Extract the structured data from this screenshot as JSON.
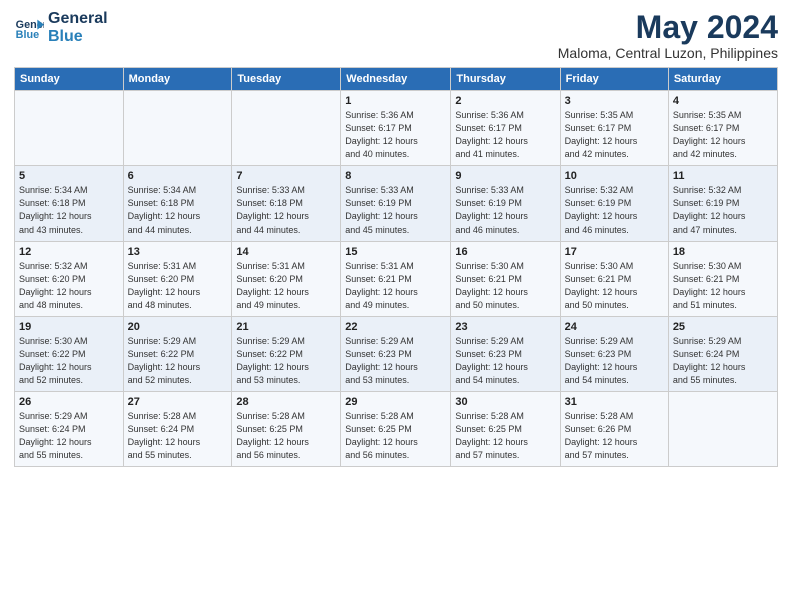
{
  "header": {
    "logo_line1": "General",
    "logo_line2": "Blue",
    "month_title": "May 2024",
    "subtitle": "Maloma, Central Luzon, Philippines"
  },
  "days_of_week": [
    "Sunday",
    "Monday",
    "Tuesday",
    "Wednesday",
    "Thursday",
    "Friday",
    "Saturday"
  ],
  "weeks": [
    [
      {
        "day": "",
        "info": ""
      },
      {
        "day": "",
        "info": ""
      },
      {
        "day": "",
        "info": ""
      },
      {
        "day": "1",
        "info": "Sunrise: 5:36 AM\nSunset: 6:17 PM\nDaylight: 12 hours\nand 40 minutes."
      },
      {
        "day": "2",
        "info": "Sunrise: 5:36 AM\nSunset: 6:17 PM\nDaylight: 12 hours\nand 41 minutes."
      },
      {
        "day": "3",
        "info": "Sunrise: 5:35 AM\nSunset: 6:17 PM\nDaylight: 12 hours\nand 42 minutes."
      },
      {
        "day": "4",
        "info": "Sunrise: 5:35 AM\nSunset: 6:17 PM\nDaylight: 12 hours\nand 42 minutes."
      }
    ],
    [
      {
        "day": "5",
        "info": "Sunrise: 5:34 AM\nSunset: 6:18 PM\nDaylight: 12 hours\nand 43 minutes."
      },
      {
        "day": "6",
        "info": "Sunrise: 5:34 AM\nSunset: 6:18 PM\nDaylight: 12 hours\nand 44 minutes."
      },
      {
        "day": "7",
        "info": "Sunrise: 5:33 AM\nSunset: 6:18 PM\nDaylight: 12 hours\nand 44 minutes."
      },
      {
        "day": "8",
        "info": "Sunrise: 5:33 AM\nSunset: 6:19 PM\nDaylight: 12 hours\nand 45 minutes."
      },
      {
        "day": "9",
        "info": "Sunrise: 5:33 AM\nSunset: 6:19 PM\nDaylight: 12 hours\nand 46 minutes."
      },
      {
        "day": "10",
        "info": "Sunrise: 5:32 AM\nSunset: 6:19 PM\nDaylight: 12 hours\nand 46 minutes."
      },
      {
        "day": "11",
        "info": "Sunrise: 5:32 AM\nSunset: 6:19 PM\nDaylight: 12 hours\nand 47 minutes."
      }
    ],
    [
      {
        "day": "12",
        "info": "Sunrise: 5:32 AM\nSunset: 6:20 PM\nDaylight: 12 hours\nand 48 minutes."
      },
      {
        "day": "13",
        "info": "Sunrise: 5:31 AM\nSunset: 6:20 PM\nDaylight: 12 hours\nand 48 minutes."
      },
      {
        "day": "14",
        "info": "Sunrise: 5:31 AM\nSunset: 6:20 PM\nDaylight: 12 hours\nand 49 minutes."
      },
      {
        "day": "15",
        "info": "Sunrise: 5:31 AM\nSunset: 6:21 PM\nDaylight: 12 hours\nand 49 minutes."
      },
      {
        "day": "16",
        "info": "Sunrise: 5:30 AM\nSunset: 6:21 PM\nDaylight: 12 hours\nand 50 minutes."
      },
      {
        "day": "17",
        "info": "Sunrise: 5:30 AM\nSunset: 6:21 PM\nDaylight: 12 hours\nand 50 minutes."
      },
      {
        "day": "18",
        "info": "Sunrise: 5:30 AM\nSunset: 6:21 PM\nDaylight: 12 hours\nand 51 minutes."
      }
    ],
    [
      {
        "day": "19",
        "info": "Sunrise: 5:30 AM\nSunset: 6:22 PM\nDaylight: 12 hours\nand 52 minutes."
      },
      {
        "day": "20",
        "info": "Sunrise: 5:29 AM\nSunset: 6:22 PM\nDaylight: 12 hours\nand 52 minutes."
      },
      {
        "day": "21",
        "info": "Sunrise: 5:29 AM\nSunset: 6:22 PM\nDaylight: 12 hours\nand 53 minutes."
      },
      {
        "day": "22",
        "info": "Sunrise: 5:29 AM\nSunset: 6:23 PM\nDaylight: 12 hours\nand 53 minutes."
      },
      {
        "day": "23",
        "info": "Sunrise: 5:29 AM\nSunset: 6:23 PM\nDaylight: 12 hours\nand 54 minutes."
      },
      {
        "day": "24",
        "info": "Sunrise: 5:29 AM\nSunset: 6:23 PM\nDaylight: 12 hours\nand 54 minutes."
      },
      {
        "day": "25",
        "info": "Sunrise: 5:29 AM\nSunset: 6:24 PM\nDaylight: 12 hours\nand 55 minutes."
      }
    ],
    [
      {
        "day": "26",
        "info": "Sunrise: 5:29 AM\nSunset: 6:24 PM\nDaylight: 12 hours\nand 55 minutes."
      },
      {
        "day": "27",
        "info": "Sunrise: 5:28 AM\nSunset: 6:24 PM\nDaylight: 12 hours\nand 55 minutes."
      },
      {
        "day": "28",
        "info": "Sunrise: 5:28 AM\nSunset: 6:25 PM\nDaylight: 12 hours\nand 56 minutes."
      },
      {
        "day": "29",
        "info": "Sunrise: 5:28 AM\nSunset: 6:25 PM\nDaylight: 12 hours\nand 56 minutes."
      },
      {
        "day": "30",
        "info": "Sunrise: 5:28 AM\nSunset: 6:25 PM\nDaylight: 12 hours\nand 57 minutes."
      },
      {
        "day": "31",
        "info": "Sunrise: 5:28 AM\nSunset: 6:26 PM\nDaylight: 12 hours\nand 57 minutes."
      },
      {
        "day": "",
        "info": ""
      }
    ]
  ]
}
